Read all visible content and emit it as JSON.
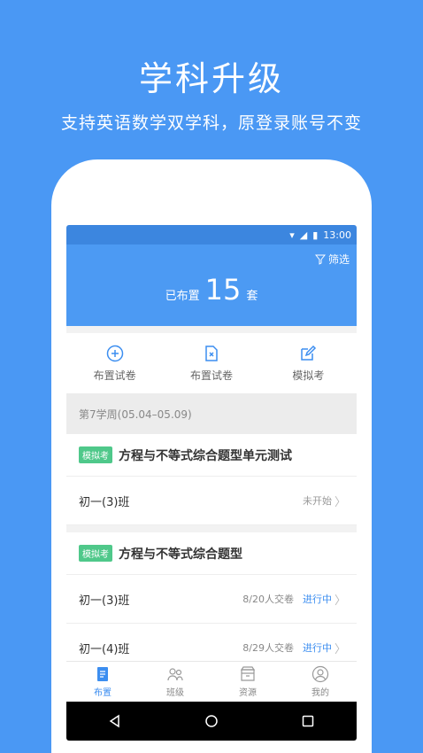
{
  "promo": {
    "title": "学科升级",
    "subtitle": "支持英语数学双学科，原登录账号不变"
  },
  "status_bar": {
    "time": "13:00"
  },
  "header": {
    "filter_label": "筛选",
    "assigned_prefix": "已布置",
    "assigned_count": "15",
    "assigned_unit": "套"
  },
  "actions": [
    {
      "label": "布置试卷",
      "icon": "plus-circle-icon"
    },
    {
      "label": "布置试卷",
      "icon": "document-x-icon"
    },
    {
      "label": "模拟考",
      "icon": "edit-icon"
    }
  ],
  "week_label": "第7学周(05.04–05.09)",
  "assignments": [
    {
      "tag": "模拟考",
      "title": "方程与不等式综合题型单元测试",
      "rows": [
        {
          "class": "初一(3)班",
          "count": "",
          "status": "未开始",
          "state": "pending"
        }
      ]
    },
    {
      "tag": "模拟考",
      "title": "方程与不等式综合题型",
      "rows": [
        {
          "class": "初一(3)班",
          "count": "8/20人交卷",
          "status": "进行中",
          "state": "active"
        },
        {
          "class": "初一(4)班",
          "count": "8/29人交卷",
          "status": "进行中",
          "state": "active"
        }
      ]
    }
  ],
  "tabs": [
    {
      "label": "布置",
      "icon": "assign-icon",
      "active": true
    },
    {
      "label": "班级",
      "icon": "people-icon",
      "active": false
    },
    {
      "label": "资源",
      "icon": "box-icon",
      "active": false
    },
    {
      "label": "我的",
      "icon": "user-icon",
      "active": false
    }
  ],
  "colors": {
    "background": "#4a98f4",
    "header": "#4c9af3",
    "accent": "#3c8ef0",
    "tag": "#4fc88a"
  }
}
